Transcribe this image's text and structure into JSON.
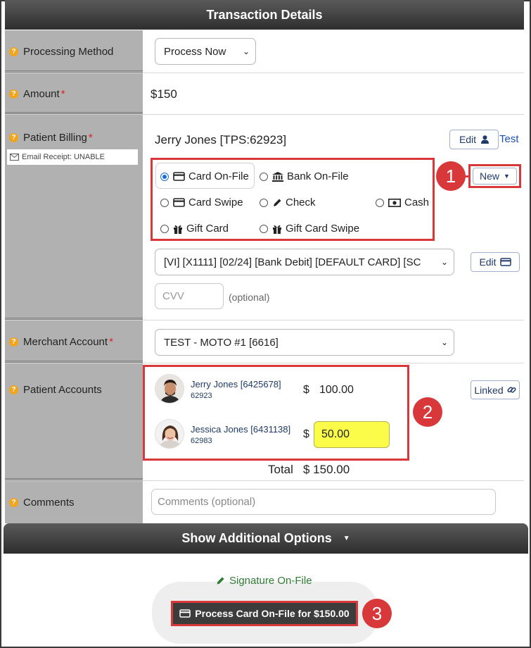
{
  "header": {
    "title": "Transaction Details"
  },
  "processing_method": {
    "label": "Processing Method",
    "value": "Process Now"
  },
  "amount": {
    "label": "Amount",
    "required_mark": "*",
    "value": "$150"
  },
  "patient_billing": {
    "label": "Patient Billing",
    "required_mark": "*",
    "email_receipt": "Email Receipt: UNABLE",
    "patient_name": "Jerry Jones [TPS:62923]",
    "edit_label": "Edit",
    "test_label": "Test",
    "new_label": "New",
    "payment_methods": [
      {
        "label": "Card On-File",
        "checked": true,
        "icon": "credit-card-icon"
      },
      {
        "label": "Bank On-File",
        "checked": false,
        "icon": "bank-icon"
      },
      {
        "label": "Card Swipe",
        "checked": false,
        "icon": "credit-card-icon"
      },
      {
        "label": "Check",
        "checked": false,
        "icon": "pencil-icon"
      },
      {
        "label": "Cash",
        "checked": false,
        "icon": "money-icon"
      },
      {
        "label": "Gift Card",
        "checked": false,
        "icon": "gift-icon"
      },
      {
        "label": "Gift Card Swipe",
        "checked": false,
        "icon": "gift-icon"
      }
    ],
    "card_select": "[VI] [X1111] [02/24] [Bank Debit] [DEFAULT CARD] [SC",
    "card_edit_label": "Edit",
    "cvv_placeholder": "CVV",
    "cvv_hint": "(optional)"
  },
  "merchant_account": {
    "label": "Merchant Account",
    "required_mark": "*",
    "value": "TEST - MOTO #1 [6616]"
  },
  "patient_accounts": {
    "label": "Patient Accounts",
    "linked_label": "Linked",
    "currency_symbol": "$",
    "accounts": [
      {
        "name": "Jerry Jones [6425678]",
        "id": "62923",
        "amount": "100.00"
      },
      {
        "name": "Jessica Jones [6431138]",
        "id": "62983",
        "amount": "50.00"
      }
    ],
    "total_label": "Total",
    "total_value": "$ 150.00"
  },
  "comments": {
    "label": "Comments",
    "placeholder": "Comments (optional)"
  },
  "additional_options": {
    "label": "Show Additional Options"
  },
  "signature": {
    "label": "Signature On-File"
  },
  "process_button": {
    "label": "Process Card On-File for $150.00"
  },
  "callouts": [
    "1",
    "2",
    "3"
  ],
  "colors": {
    "callout_red": "#d9383a",
    "link_blue": "#1f3a6a",
    "highlight_yellow": "#fbfb4a",
    "signature_green": "#2e7d32"
  }
}
